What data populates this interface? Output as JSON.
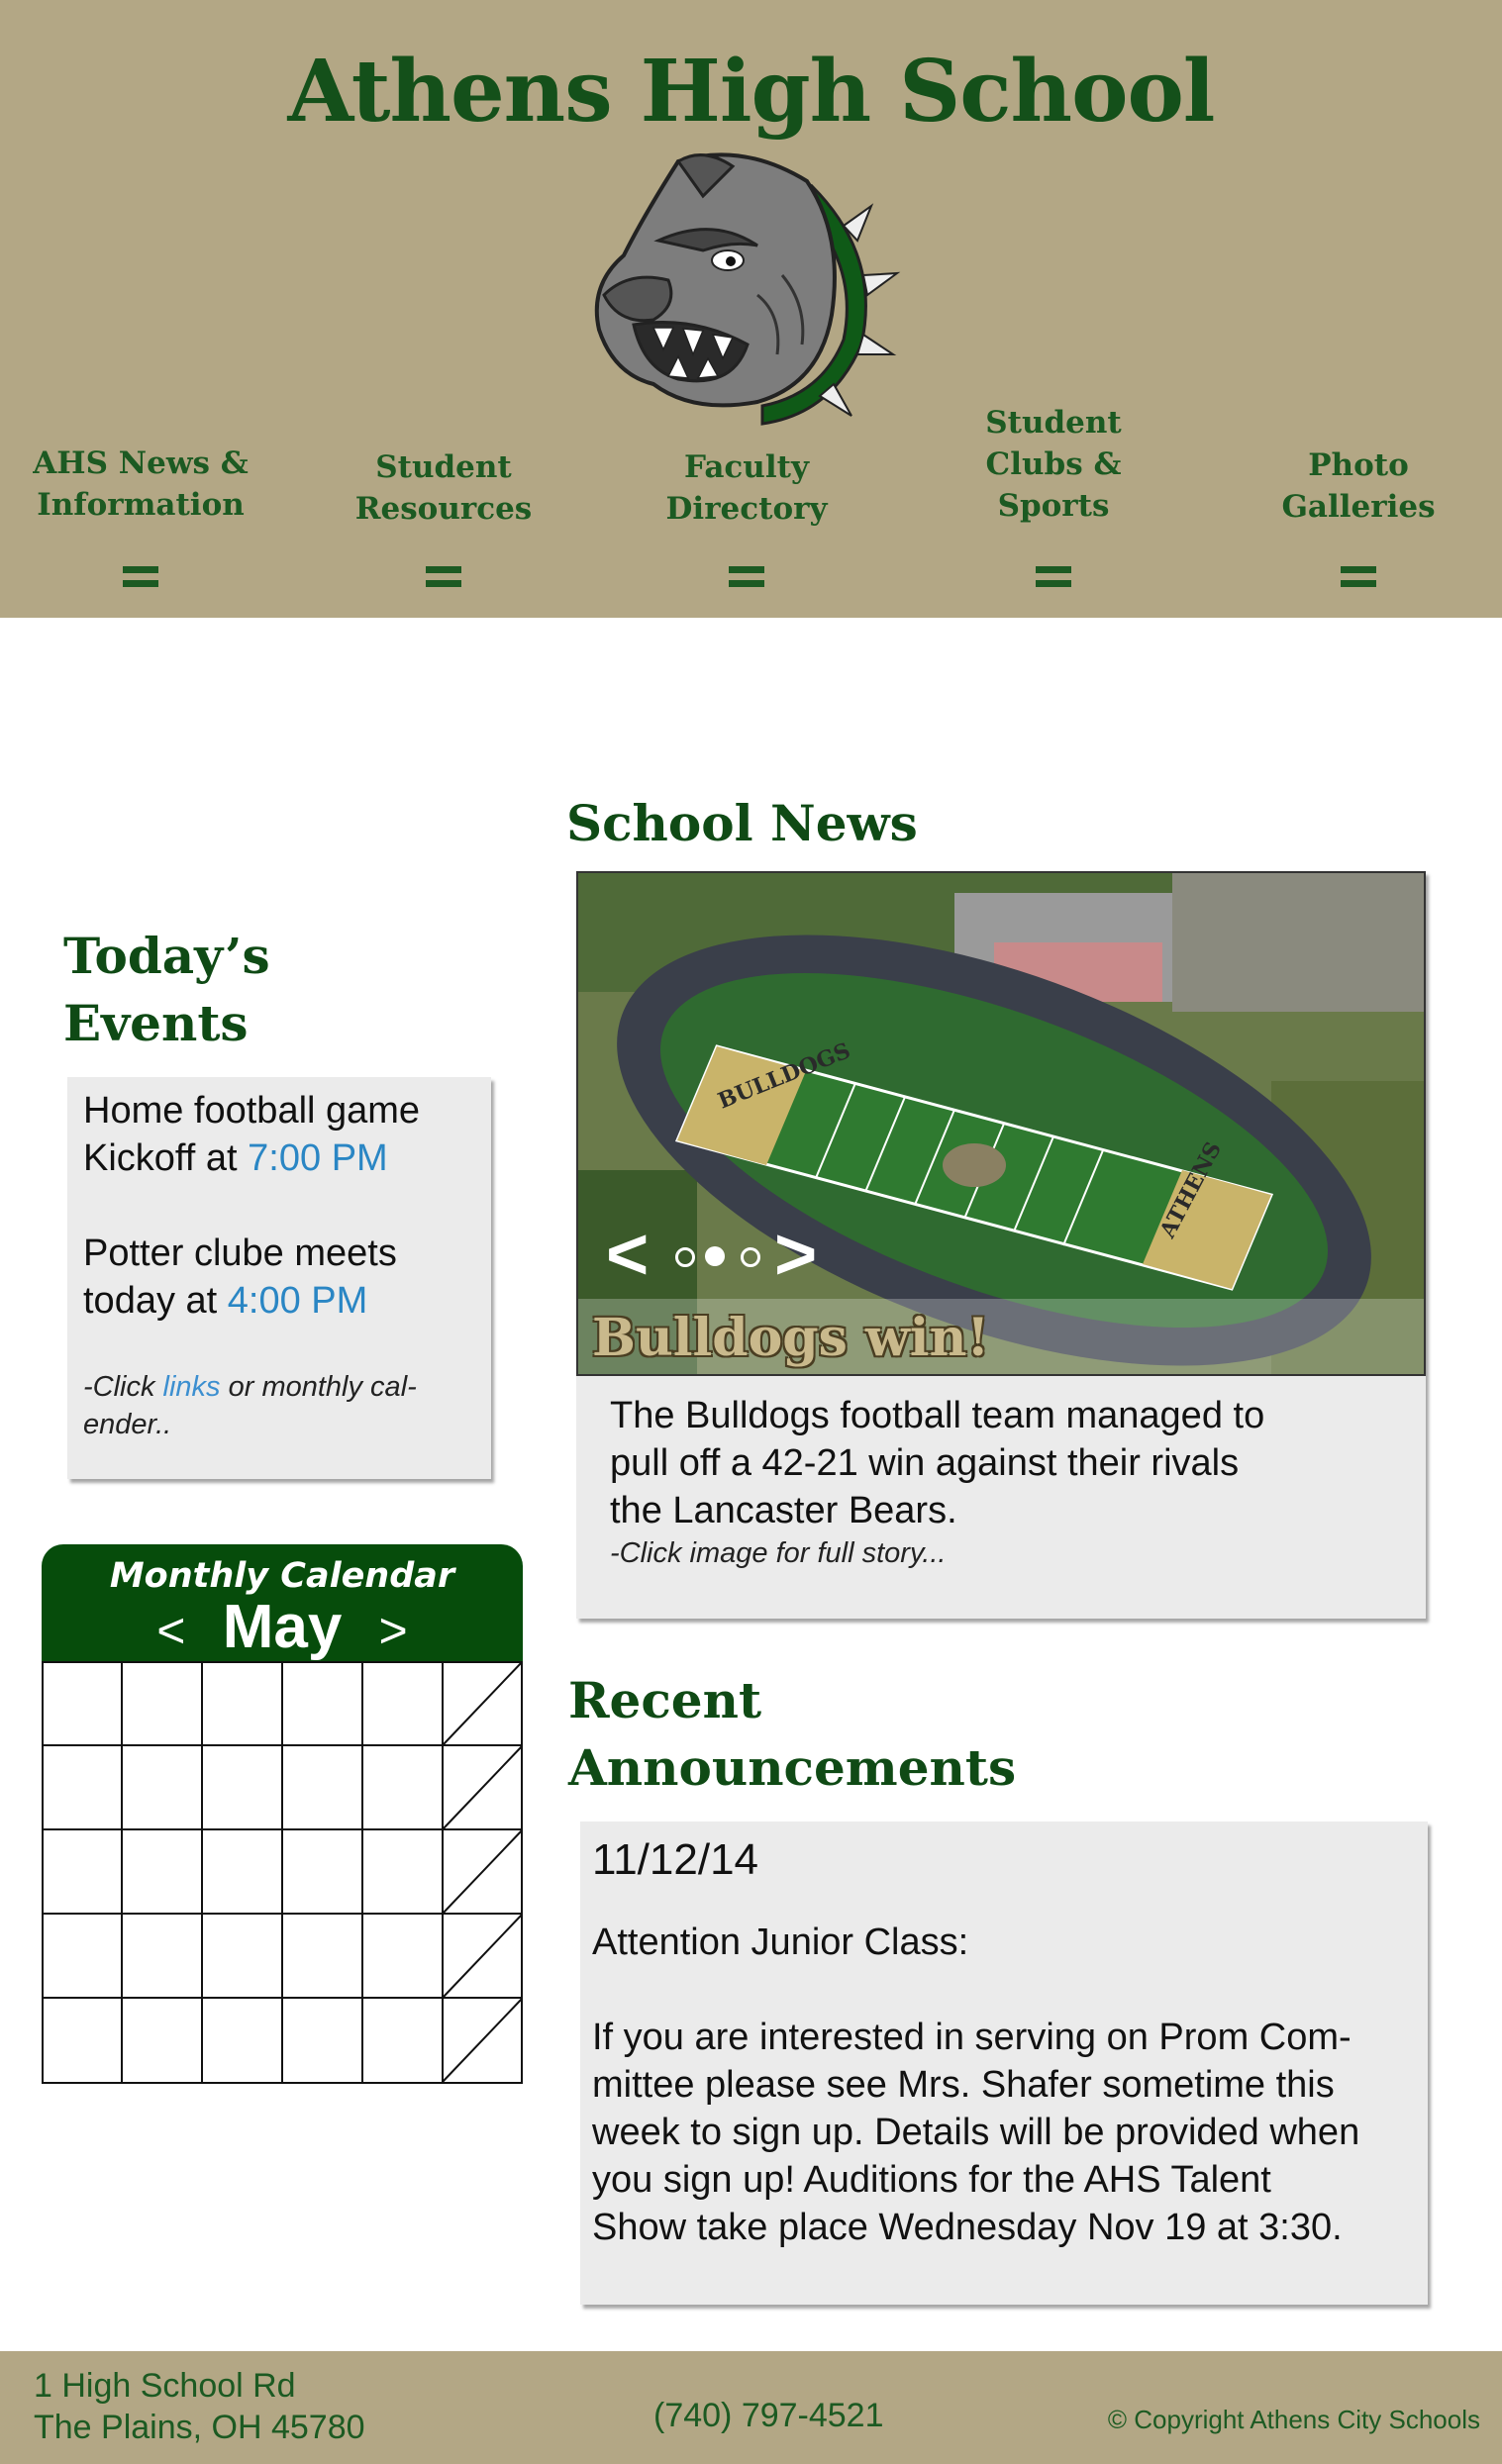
{
  "header": {
    "title": "Athens High School",
    "mascot_icon": "bulldog-mascot-icon",
    "colors": {
      "brand_green": "#14501a",
      "header_tan": "#b3a785"
    }
  },
  "nav": {
    "items": [
      {
        "line1": "AHS News &",
        "line2": "Information",
        "line3": "",
        "icon": "menu-icon"
      },
      {
        "line1": "Student",
        "line2": "Resources",
        "line3": "",
        "icon": "menu-icon"
      },
      {
        "line1": "Faculty",
        "line2": "Directory",
        "line3": "",
        "icon": "menu-icon"
      },
      {
        "line1": "Student",
        "line2": "Clubs &",
        "line3": "Sports",
        "icon": "menu-icon"
      },
      {
        "line1": "Photo",
        "line2": "Galleries",
        "line3": "",
        "icon": "menu-icon"
      }
    ]
  },
  "events": {
    "heading_line1": "Today’s",
    "heading_line2": "Events",
    "event1_line1": "Home football game",
    "event1_prefix": "Kickoff at ",
    "event1_time": "7:00 PM",
    "event2_line1": "Potter clube meets",
    "event2_prefix": "today at ",
    "event2_time": "4:00 PM",
    "note_prefix": "-Click ",
    "note_link": "links",
    "note_suffix": " or monthly cal-",
    "note_line2": "ender.."
  },
  "calendar": {
    "title": "Monthly Calendar",
    "month": "May",
    "prev": "<",
    "next": ">"
  },
  "news": {
    "heading": "School News",
    "slide_caption": "Bulldogs win!",
    "carousel_prev": "<",
    "carousel_next": ">",
    "slide_count": 3,
    "active_slide": 2,
    "field_endzone_1": "BULLDOGS",
    "field_endzone_2": "ATHENS",
    "body_line1": "The Bulldogs football team managed to",
    "body_line2": "pull off a 42-21 win against their rivals",
    "body_line3": "the Lancaster Bears.",
    "note": "-Click image for full story..."
  },
  "announcements": {
    "heading_line1": "Recent",
    "heading_line2": "Announcements",
    "date": "11/12/14",
    "subject": "Attention Junior Class:",
    "body_line1": "If you are interested in serving on  Prom Com-",
    "body_line2": "mittee please see Mrs. Shafer sometime this",
    "body_line3": "week to sign up.  Details will be provided when",
    "body_line4": "you sign up! Auditions for the AHS Talent",
    "body_line5": "Show take place Wednesday Nov 19 at 3:30."
  },
  "footer": {
    "address_line1": "1 High School Rd",
    "address_line2": "The Plains, OH 45780",
    "phone": "(740) 797-4521",
    "copyright": "© Copyright Athens City Schools"
  }
}
